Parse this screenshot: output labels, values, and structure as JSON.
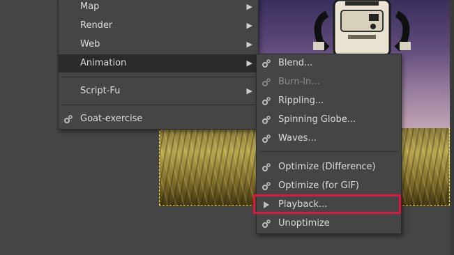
{
  "main_menu": {
    "items": [
      {
        "label": "Map",
        "has_submenu": true
      },
      {
        "label": "Render",
        "has_submenu": true
      },
      {
        "label": "Web",
        "has_submenu": true
      },
      {
        "label": "Animation",
        "has_submenu": true,
        "highlighted": true
      },
      {
        "label": "Script-Fu",
        "has_submenu": true
      },
      {
        "label": "Goat-exercise",
        "icon": "gear-icon"
      }
    ]
  },
  "animation_submenu": {
    "items": [
      {
        "label": "Blend...",
        "icon": "gear-icon"
      },
      {
        "label": "Burn-In...",
        "icon": "gear-icon",
        "disabled": true
      },
      {
        "label": "Rippling...",
        "icon": "gear-icon"
      },
      {
        "label": "Spinning Globe...",
        "icon": "gear-icon"
      },
      {
        "label": "Waves...",
        "icon": "gear-icon"
      },
      {
        "label": "Optimize (Difference)",
        "icon": "gear-icon"
      },
      {
        "label": "Optimize (for GIF)",
        "icon": "gear-icon"
      },
      {
        "label": "Playback...",
        "icon": "play-icon",
        "annotated": true
      },
      {
        "label": "Unoptimize",
        "icon": "gear-icon"
      }
    ]
  },
  "colors": {
    "menu_bg": "#454545",
    "highlight_bg": "#2b2b2b",
    "annotation_red": "#e0173d",
    "selection_dash": "#f4e24a"
  }
}
